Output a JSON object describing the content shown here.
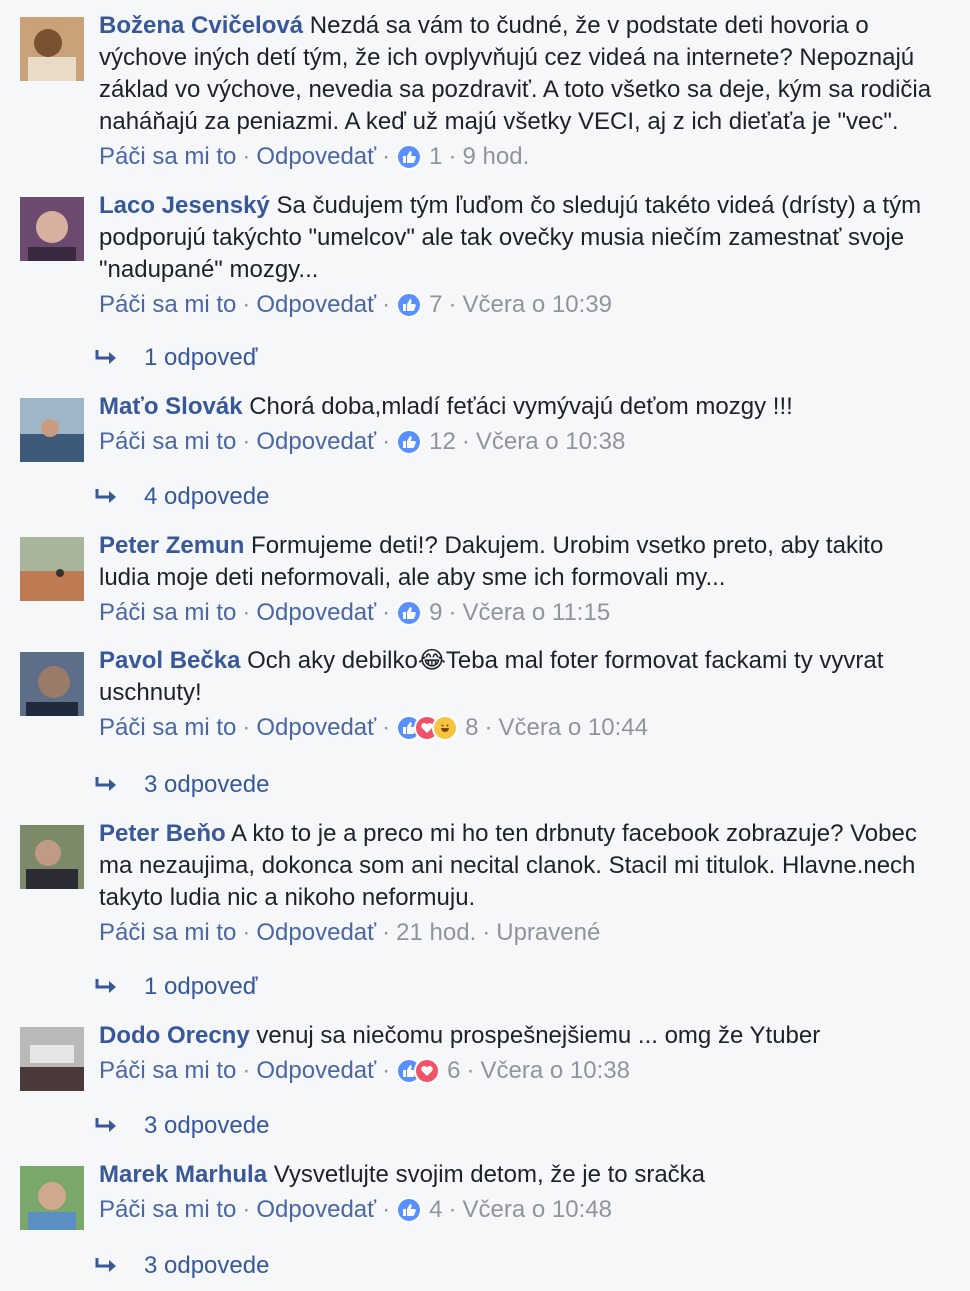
{
  "labels": {
    "like": "Páči sa mi to",
    "reply": "Odpovedať",
    "dot": "·"
  },
  "colors": {
    "link": "#385898",
    "meta": "#90949c",
    "like": "#5890ff",
    "love": "#f25268",
    "haha": "#f7c442"
  },
  "comments": [
    {
      "author": "Božena Cvičelová",
      "text": "Nezdá sa vám to čudné, že v podstate deti hovoria o výchove iných detí tým, že ich ovplyvňujú cez videá na internete? Nepoznajú základ vo výchove, nevedia sa pozdraviť. A toto všetko sa deje, kým sa rodičia naháňajú za peniazmi. A keď už majú všetky VECI, aj z ich dieťaťa je \"vec\".",
      "reactions": [
        "like-icon"
      ],
      "count": "1",
      "time": "9 hod.",
      "replies": ""
    },
    {
      "author": "Laco Jesenský",
      "text": "Sa čudujem tým ľuďom čo sledujú takéto videá (drísty) a tým podporujú takýchto \"umelcov\" ale tak ovečky musia niečím zamestnať svoje \"nadupané\" mozgy...",
      "reactions": [
        "like-icon"
      ],
      "count": "7",
      "time": "Včera o 10:39",
      "replies": "1 odpoveď"
    },
    {
      "author": "Maťo Slovák",
      "text": "Chorá doba,mladí feťáci vymývajú deťom mozgy !!!",
      "reactions": [
        "like-icon"
      ],
      "count": "12",
      "time": "Včera o 10:38",
      "replies": "4 odpovede"
    },
    {
      "author": "Peter Zemun",
      "text": "Formujeme deti!? Dakujem. Urobim vsetko preto, aby takito ludia moje deti neformovali, ale aby sme ich formovali my...",
      "reactions": [
        "like-icon"
      ],
      "count": "9",
      "time": "Včera o 11:15",
      "replies": ""
    },
    {
      "author": "Pavol Bečka",
      "text": "Och aky debilko😂Teba mal foter formovat fackami ty vyvrat uschnuty!",
      "reactions": [
        "like-icon",
        "love-icon",
        "haha-icon"
      ],
      "count": "8",
      "time": "Včera o 10:44",
      "replies": "3 odpovede"
    },
    {
      "author": "Peter Beňo",
      "text": "A kto to je a preco mi ho ten drbnuty facebook zobrazuje? Vobec ma nezaujima, dokonca som ani necital clanok. Stacil mi titulok. Hlavne.nech takyto ludia nic a nikoho neformuju.",
      "reactions": [],
      "count": "",
      "time": "21 hod.",
      "edited": "Upravené",
      "replies": "1 odpoveď"
    },
    {
      "author": "Dodo Orecny",
      "text": "venuj sa niečomu prospešnejšiemu ... omg že Ytuber",
      "reactions": [
        "like-icon",
        "love-icon"
      ],
      "count": "6",
      "time": "Včera o 10:38",
      "replies": "3 odpovede"
    },
    {
      "author": "Marek Marhula",
      "text": "Vysvetlujte svojim detom, že je to sračka",
      "reactions": [
        "like-icon"
      ],
      "count": "4",
      "time": "Včera o 10:48",
      "replies": "3 odpovede"
    }
  ]
}
